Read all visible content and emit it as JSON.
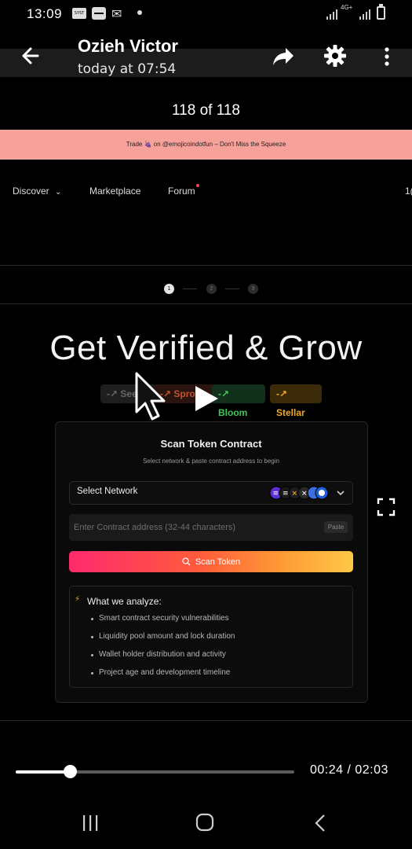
{
  "status_bar": {
    "time": "13:09",
    "badge_text": "SYST",
    "network_type": "4G+",
    "icons": [
      "notification-badge-icon",
      "storage-icon",
      "chat-icon",
      "dot-icon",
      "signal-icon",
      "battery-icon"
    ]
  },
  "header": {
    "title": "Ozieh Victor",
    "subtitle": "today at 07:54",
    "counter": "118 of 118",
    "icons": [
      "back-arrow-icon",
      "share-icon",
      "settings-gear-icon",
      "more-vertical-icon"
    ]
  },
  "page": {
    "banner_text": "Trade 🍇 on @emojicoindotfun – Don't Miss the Squeeze",
    "nav": {
      "discover": "Discover",
      "marketplace": "Marketplace",
      "forum": "Forum",
      "edge_text": "1("
    },
    "steps": [
      "1",
      "2",
      "3"
    ],
    "hero_title": "Get Verified & Grow",
    "tiers": [
      {
        "label": "Seed",
        "color": "#666666"
      },
      {
        "label": "Sprout",
        "color": "#c4532f"
      },
      {
        "label": "Bloom",
        "color": "#3fc857"
      },
      {
        "label": "Stellar",
        "color": "#f3a91c"
      }
    ],
    "card": {
      "title": "Scan Token Contract",
      "subtitle": "Select network & paste contract address to begin",
      "network_label": "Select Network",
      "contract_placeholder": "Enter Contract address (32-44 characters)",
      "paste_label": "Paste",
      "scan_label": "Scan Token",
      "analyze_title": "What we analyze:",
      "analyze_items": [
        "Smart contract security vulnerabilities",
        "Liquidity pool amount and lock duration",
        "Wallet holder distribution and activity",
        "Project age and development timeline"
      ]
    }
  },
  "player": {
    "time_display": "00:24 / 02:03",
    "progress": 0.195
  },
  "colors": {
    "banner": "#f6a199",
    "scan_gradient_start": "#ff2a6d",
    "scan_gradient_end": "#ffc847",
    "background": "#000000"
  }
}
